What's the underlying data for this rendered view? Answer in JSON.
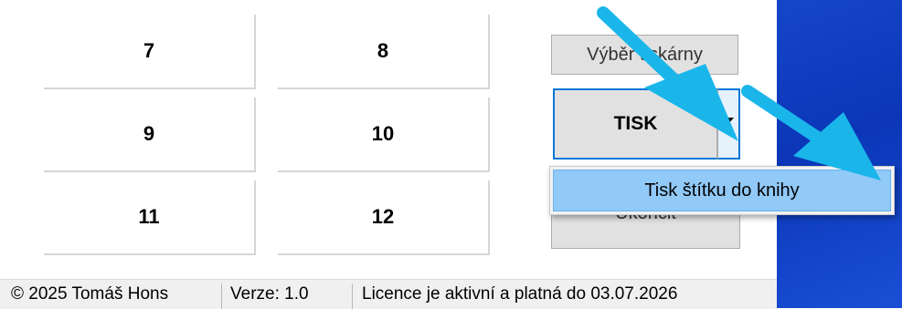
{
  "numpad": {
    "buttons": [
      "7",
      "8",
      "9",
      "10",
      "11",
      "12"
    ]
  },
  "side": {
    "printer_select_label": "Výběr tiskárny",
    "print_label": "TISK",
    "exit_label": "Ukončit"
  },
  "dropdown_menu": {
    "items": [
      "Tisk štítku do knihy"
    ]
  },
  "statusbar": {
    "copyright": "© 2025 Tomáš Hons",
    "version": "Verze: 1.0",
    "license": "Licence je aktivní a platná do 03.07.2026"
  },
  "colors": {
    "desktop": "#1646c8",
    "focus_border": "#0078d7",
    "menu_highlight": "#91c9f7",
    "annotation_arrow": "#1ab6ea"
  }
}
